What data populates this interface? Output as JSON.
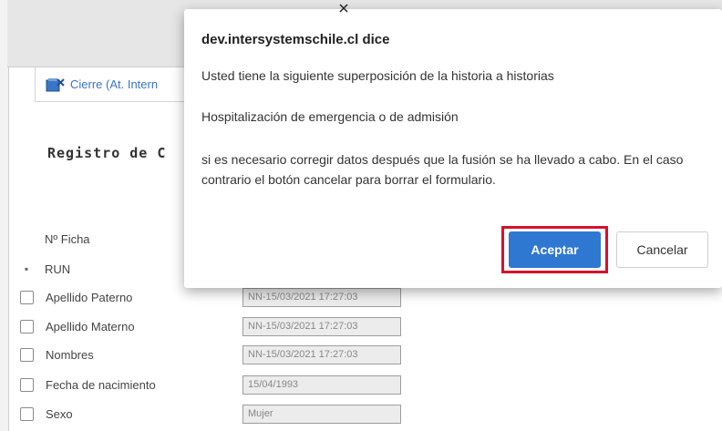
{
  "background": {
    "tab_label": "Cierre (At. Intern",
    "section_title": "Registro de C",
    "rows": [
      {
        "label": "Nº Ficha",
        "marker": "none",
        "value": ""
      },
      {
        "label": "RUN",
        "marker": "bullet",
        "value": ""
      },
      {
        "label": "Apellido Paterno",
        "marker": "checkbox",
        "value": "NN-15/03/2021 17:27:03"
      },
      {
        "label": "Apellido Materno",
        "marker": "checkbox",
        "value": "NN-15/03/2021 17:27:03"
      },
      {
        "label": "Nombres",
        "marker": "checkbox",
        "value": "NN-15/03/2021 17:27:03"
      },
      {
        "label": "Fecha de nacimiento",
        "marker": "checkbox",
        "value": "15/04/1993"
      },
      {
        "label": "Sexo",
        "marker": "checkbox",
        "value": "Mujer"
      }
    ]
  },
  "dialog": {
    "title": "dev.intersystemschile.cl dice",
    "line1": "Usted tiene la siguiente superposición de la historia a historias",
    "line2": "Hospitalización de emergencia o de admisión",
    "line3": "si es necesario corregir  datos después que la fusión se ha llevado a cabo. En el caso contrario el botón cancelar para borrar el formulario.",
    "accept_label": "Aceptar",
    "cancel_label": "Cancelar"
  },
  "colors": {
    "accent": "#2f78d2",
    "highlight": "#d8102a"
  },
  "icons": {
    "tab_icon": "close-record-icon",
    "bullet": "bullet-icon"
  }
}
